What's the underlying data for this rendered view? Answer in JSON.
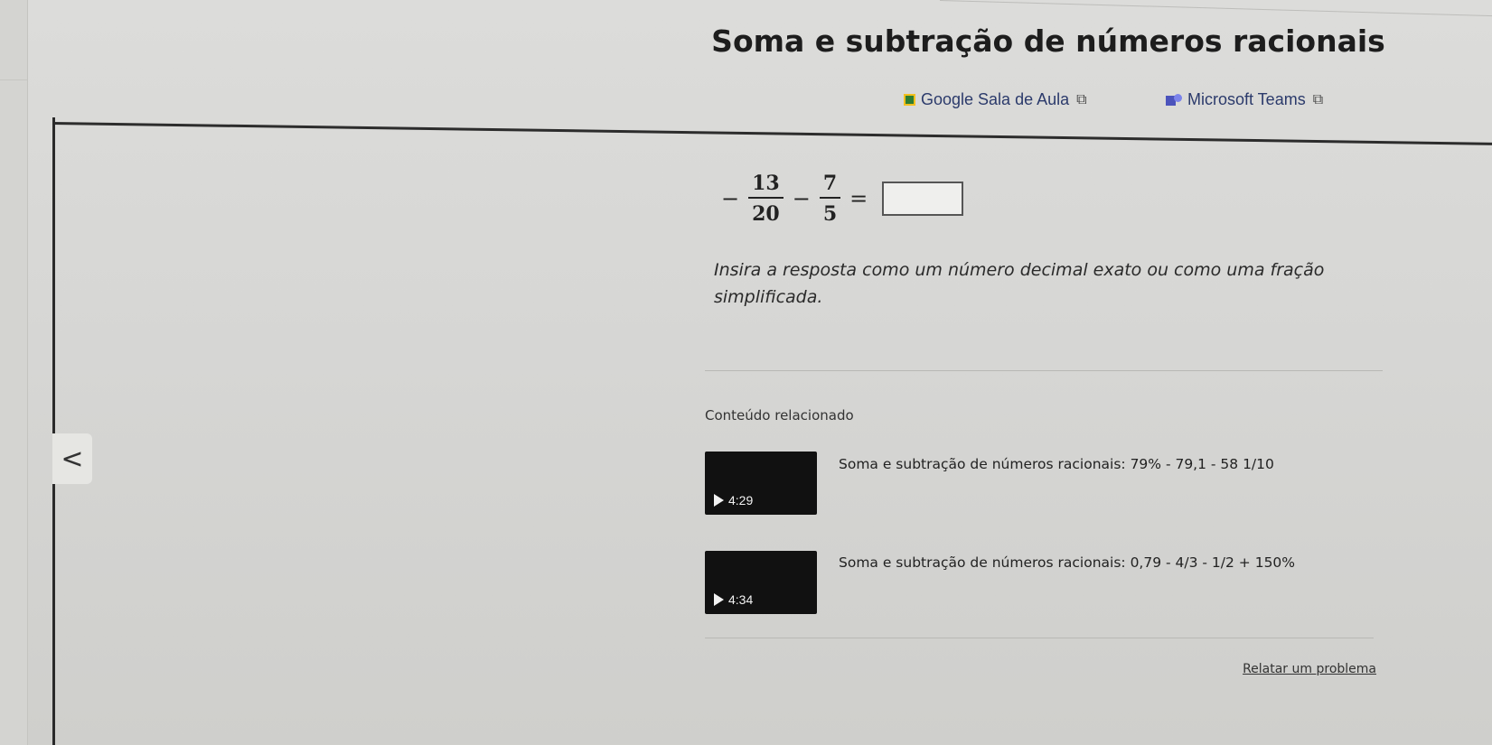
{
  "page": {
    "title": "Soma e subtração de números racionais"
  },
  "share": {
    "google_label": "Google Sala de Aula",
    "teams_label": "Microsoft Teams",
    "external_icon": "external-link-icon"
  },
  "problem": {
    "sign1": "−",
    "frac1_num": "13",
    "frac1_den": "20",
    "op": "−",
    "frac2_num": "7",
    "frac2_den": "5",
    "equals": "=",
    "answer_value": ""
  },
  "instructions": "Insira a resposta como um número decimal exato ou como uma fração simplificada.",
  "related": {
    "heading": "Conteúdo relacionado",
    "prev_arrow": "<",
    "videos": [
      {
        "title": "Soma e subtração de números racionais: 79% - 79,1 - 58 1/10",
        "duration": "4:29"
      },
      {
        "title": "Soma e subtração de números racionais: 0,79 - 4/3 - 1/2 + 150%",
        "duration": "4:34"
      }
    ]
  },
  "footer": {
    "report_label": "Relatar um problema"
  }
}
